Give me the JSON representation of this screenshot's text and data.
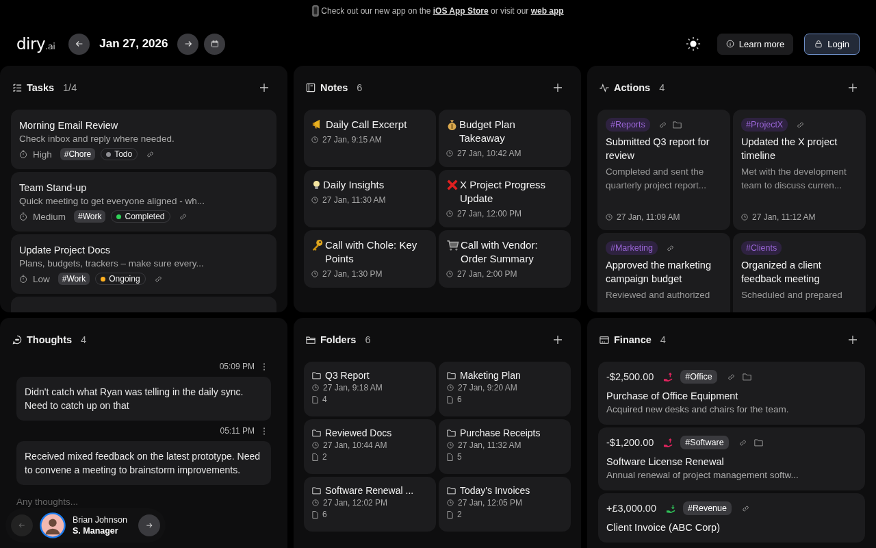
{
  "banner": {
    "before": "Check out our new app on the ",
    "link_1": "iOS App Store",
    "middle": " or visit our ",
    "link_2": "web app"
  },
  "header": {
    "logo": {
      "name": "diry",
      "suffix": ".ai"
    },
    "date": "Jan 27, 2026",
    "learn_more": "Learn more",
    "login": "Login"
  },
  "tasks": {
    "title": "Tasks",
    "count": "1/4",
    "add_button": true,
    "items": [
      {
        "title": "Morning Email Review",
        "description": "Check inbox and reply where needed.",
        "priority": "High",
        "tag": "#Chore",
        "status": {
          "label": "Todo",
          "color": "#8e8e93"
        }
      },
      {
        "title": "Team Stand-up",
        "description": "Quick meeting to get everyone aligned - wh...",
        "priority": "Medium",
        "tag": "#Work",
        "status": {
          "label": "Completed",
          "color": "#30d158"
        }
      },
      {
        "title": "Update Project Docs",
        "description": "Plans, budgets, trackers – make sure every...",
        "priority": "Low",
        "tag": "#Work",
        "status": {
          "label": "Ongoing",
          "color": "#ffb020"
        }
      },
      {
        "kind": "peek"
      }
    ]
  },
  "notes": {
    "title": "Notes",
    "count": "6",
    "add_button": true,
    "items": [
      {
        "kind": "megaphone",
        "title": "Daily Call Excerpt",
        "time": "27 Jan, 9:15 AM"
      },
      {
        "kind": "moneybag",
        "title": "Budget Plan Takeaway",
        "time": "27 Jan, 10:42 AM"
      },
      {
        "kind": "bulb",
        "title": "Daily Insights",
        "time": "27 Jan, 11:30 AM"
      },
      {
        "kind": "cross",
        "title": "X Project Progress Update",
        "time": "27 Jan, 12:00 PM"
      },
      {
        "kind": "key",
        "title": "Call with Chole: Key Points",
        "time": "27 Jan, 1:30 PM"
      },
      {
        "kind": "cart",
        "title": "Call with Vendor: Order Summary",
        "time": "27 Jan, 2:00 PM"
      }
    ]
  },
  "actions": {
    "title": "Actions",
    "count": "4",
    "add_button": true,
    "items": [
      {
        "tag": "#Reports",
        "linked": true,
        "in_folder": true,
        "title": "Submitted Q3 report for review",
        "description": "Completed and sent the quarterly project report...",
        "time": "27 Jan, 11:09 AM"
      },
      {
        "tag": "#ProjectX",
        "linked": true,
        "in_folder": false,
        "title": "Updated the X project timeline",
        "description": "Met with the development team to discuss curren...",
        "time": "27 Jan, 11:12 AM"
      },
      {
        "tag": "#Marketing",
        "linked": true,
        "in_folder": false,
        "title": "Approved the marketing campaign budget",
        "description": "Reviewed and authorized"
      },
      {
        "tag": "#Clients",
        "linked": false,
        "in_folder": false,
        "title": "Organized a client feedback meeting",
        "description": "Scheduled and prepared"
      }
    ]
  },
  "thoughts": {
    "title": "Thoughts",
    "count": "4",
    "add_button": false,
    "items": [
      {
        "time": "05:09 PM",
        "text": "Didn't catch what Ryan was telling in the daily sync. Need to catch up on that"
      },
      {
        "time": "05:11 PM",
        "text": "Received mixed feedback on the latest prototype. Need to convene a meeting to brainstorm improvements."
      }
    ],
    "placeholder": "Any thoughts..."
  },
  "folders": {
    "title": "Folders",
    "count": "6",
    "add_button": true,
    "items": [
      {
        "name": "Q3 Report",
        "time": "27 Jan, 9:18 AM",
        "files": "4"
      },
      {
        "name": "Maketing Plan",
        "time": "27 Jan, 9:20 AM",
        "files": "6"
      },
      {
        "name": "Reviewed Docs",
        "time": "27 Jan, 10:44 AM",
        "files": "2"
      },
      {
        "name": "Purchase Receipts",
        "time": "27 Jan, 11:32 AM",
        "files": "5"
      },
      {
        "name": "Software Renewal ...",
        "time": "27 Jan, 12:02 PM",
        "files": "6"
      },
      {
        "name": "Today's Invoices",
        "time": "27 Jan, 12:05 PM",
        "files": "2"
      }
    ]
  },
  "finance": {
    "title": "Finance",
    "count": "4",
    "add_button": true,
    "items": [
      {
        "amount": "-$2,500.00",
        "kind": "expense",
        "tag": "#Office",
        "in_folder": true,
        "title": "Purchase of Office Equipment",
        "description": "Acquired new desks and chairs for the team."
      },
      {
        "amount": "-$1,200.00",
        "kind": "expense",
        "tag": "#Software",
        "in_folder": true,
        "title": "Software License Renewal",
        "description": "Annual renewal of project management softw..."
      },
      {
        "amount": "+£3,000.00",
        "kind": "income",
        "tag": "#Revenue",
        "in_folder": false,
        "title": "Client Invoice (ABC Corp)"
      }
    ]
  },
  "user": {
    "name": "Brian Johnson",
    "role": "S. Manager"
  }
}
